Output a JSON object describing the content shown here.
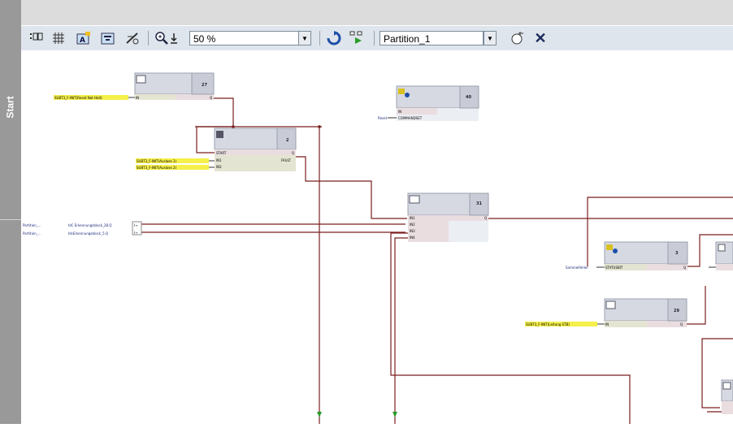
{
  "sidebar": {
    "label": "Start"
  },
  "toolbar": {
    "zoom_value": "50 %",
    "partition_value": "Partition_1",
    "icons": [
      "show-parameters-icon",
      "grid-icon",
      "auto-route-icon",
      "layout-icon",
      "line-routing-icon",
      "zoom-icon",
      "zoom-down-icon",
      "refresh-icon",
      "simulation-icon",
      "add-icon",
      "close-icon"
    ]
  },
  "diagram": {
    "blocks": [
      {
        "id": "b27",
        "number": "27",
        "icon": "sr-icon",
        "inputs": [
          "IN"
        ],
        "outputs": [
          "Q"
        ],
        "inputs_conn": [
          "SUBT3_F-INIT(Reset Not Halt)"
        ]
      },
      {
        "id": "b2",
        "number": "2",
        "icon": "start-icon",
        "inputs": [
          "START",
          "IN1",
          "IN2"
        ],
        "outputs": [
          "Q",
          "FAULT"
        ],
        "inputs_conn": [
          "",
          "SUBT3_F-INIT(Ausloes 1)",
          "SUBT3_F-INIT(Ausloes 2)"
        ]
      },
      {
        "id": "b40",
        "number": "40",
        "icon": "message-icon",
        "inputs": [
          "IN",
          "COMMANDSET"
        ],
        "outputs": [],
        "inputs_conn": [
          "",
          "Reset"
        ]
      },
      {
        "id": "b31",
        "number": "31",
        "icon": "and-icon",
        "inputs": [
          "IN1",
          "IN2",
          "IN3",
          "IN4"
        ],
        "outputs": [
          "Q"
        ]
      },
      {
        "id": "b3",
        "number": "3",
        "icon": "message-icon",
        "inputs": [
          "STATUSBIT"
        ],
        "outputs": [
          "Q"
        ],
        "inputs_conn": [
          "Sammelfehler"
        ]
      },
      {
        "id": "b29",
        "number": "29",
        "icon": "sr-icon",
        "inputs": [
          "IN"
        ],
        "outputs": [
          "Q"
        ],
        "inputs_conn": [
          "SUBT3_F-INIT(Leitung STB)"
        ]
      }
    ],
    "partition_rows": [
      {
        "partition": "Partition_...",
        "signal": "IdC Erkennungsblock_28.Q"
      },
      {
        "partition": "Partition_...",
        "signal": "IdcErkennungsblock_5.Q"
      }
    ]
  }
}
